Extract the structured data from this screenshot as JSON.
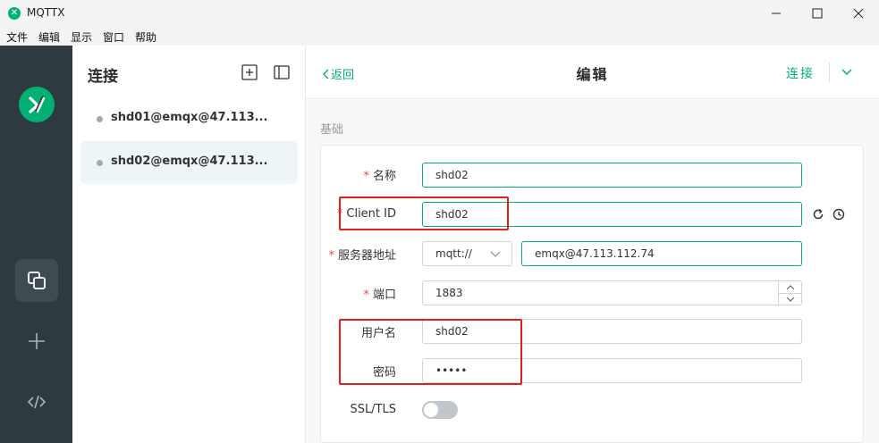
{
  "window": {
    "title": "MQTTX",
    "app_icon_glyph": "✕"
  },
  "menu": [
    "文件",
    "编辑",
    "显示",
    "窗口",
    "帮助"
  ],
  "rail": {
    "items": [
      {
        "name": "connections",
        "icon": "copy-icon",
        "active": true
      },
      {
        "name": "new-connection",
        "icon": "plus-icon",
        "active": false
      },
      {
        "name": "script",
        "icon": "code-icon",
        "active": false
      }
    ]
  },
  "connections": {
    "title": "连接",
    "items": [
      {
        "name": "shd01@emqx@47.113...",
        "selected": false
      },
      {
        "name": "shd02@emqx@47.113...",
        "selected": true
      }
    ]
  },
  "editor": {
    "back_label": "返回",
    "title": "编辑",
    "connect_label": "连接",
    "section_basic": "基础",
    "fields": {
      "name": {
        "label": "名称",
        "value": "shd02",
        "required": true
      },
      "client_id": {
        "label": "Client ID",
        "value": "shd02",
        "required": true
      },
      "host": {
        "label": "服务器地址",
        "protocol": "mqtt://",
        "value": "emqx@47.113.112.74",
        "required": true
      },
      "port": {
        "label": "端口",
        "value": "1883",
        "required": true
      },
      "username": {
        "label": "用户名",
        "value": "shd02",
        "required": false
      },
      "password": {
        "label": "密码",
        "value": "•••••",
        "required": false
      },
      "ssl": {
        "label": "SSL/TLS",
        "enabled": false
      }
    }
  },
  "colors": {
    "accent": "#00b173",
    "rail_bg": "#2f3a40",
    "annotation": "#e02020"
  }
}
